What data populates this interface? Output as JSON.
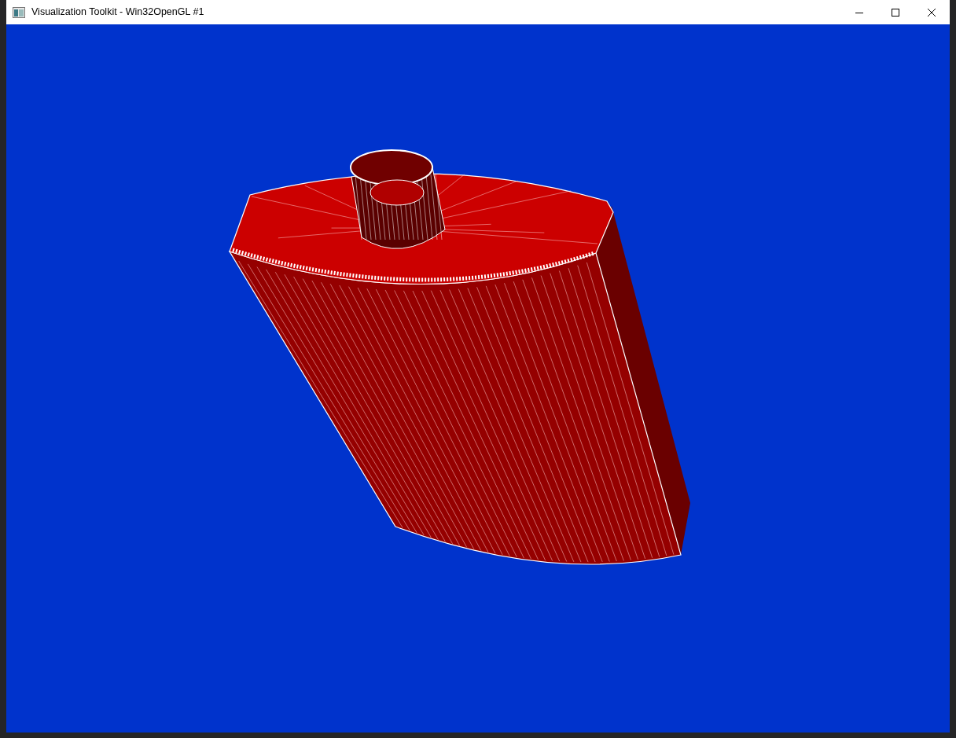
{
  "window": {
    "title": "Visualization Toolkit - Win32OpenGL #1",
    "controls": [
      {
        "kind": "minimize"
      },
      {
        "kind": "maximize"
      },
      {
        "kind": "close"
      }
    ]
  }
}
